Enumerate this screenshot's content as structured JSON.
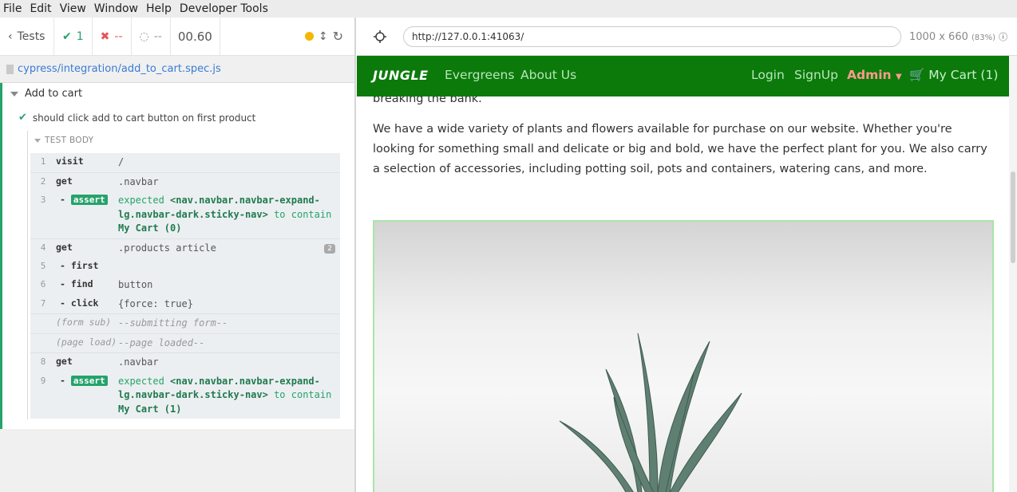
{
  "menu": [
    "File",
    "Edit",
    "View",
    "Window",
    "Help",
    "Developer Tools"
  ],
  "reporter": {
    "tests_label": "Tests",
    "passed": "1",
    "failed": "--",
    "pending": "--",
    "duration": "00.60",
    "spec_path": "cypress/integration/add_to_cart.spec.js",
    "suite": "Add to cart",
    "test": "should click add to cart button on first product",
    "body_header": "TEST BODY",
    "commands": [
      {
        "num": "1",
        "name": "visit",
        "msg": "/"
      },
      {
        "num": "2",
        "name": "get",
        "msg": ".navbar"
      },
      {
        "num": "3",
        "name": "assert",
        "msg_prefix": "expected",
        "msg_sel": "<nav.navbar.navbar-expand-lg.navbar-dark.sticky-nav>",
        "msg_mid": "to contain",
        "msg_val": "My Cart (0)"
      },
      {
        "num": "4",
        "name": "get",
        "msg": ".products article",
        "count": "2"
      },
      {
        "num": "5",
        "name": "- first",
        "msg": ""
      },
      {
        "num": "6",
        "name": "- find",
        "msg": "button"
      },
      {
        "num": "7",
        "name": "- click",
        "msg": "{force: true}"
      },
      {
        "num": "",
        "name": "(form sub)",
        "msg": "--submitting form--"
      },
      {
        "num": "",
        "name": "(page load)",
        "msg": "--page loaded--"
      },
      {
        "num": "8",
        "name": "get",
        "msg": ".navbar"
      },
      {
        "num": "9",
        "name": "assert",
        "msg_prefix": "expected",
        "msg_sel": "<nav.navbar.navbar-expand-lg.navbar-dark.sticky-nav>",
        "msg_mid": "to contain",
        "msg_val": "My Cart (1)"
      }
    ]
  },
  "aut": {
    "url": "http://127.0.0.1:41063/",
    "size": "1000 x 660",
    "scale": "(83%)"
  },
  "site": {
    "brand": "JUNGLE",
    "nav": [
      "Evergreens",
      "About Us"
    ],
    "login": "Login",
    "signup": "SignUp",
    "admin": "Admin",
    "cart": "My Cart (1)",
    "text_cut": "breaking the bank.",
    "paragraph": "We have a wide variety of plants and flowers available for purchase on our website. Whether you're looking for something small and delicate or big and bold, we have the perfect plant for you. We also carry a selection of accessories, including potting soil, pots and containers, watering cans, and more."
  },
  "colors": {
    "pass": "#25a36a",
    "navbar": "#0b7a0b",
    "admin": "#ff9b8b"
  }
}
